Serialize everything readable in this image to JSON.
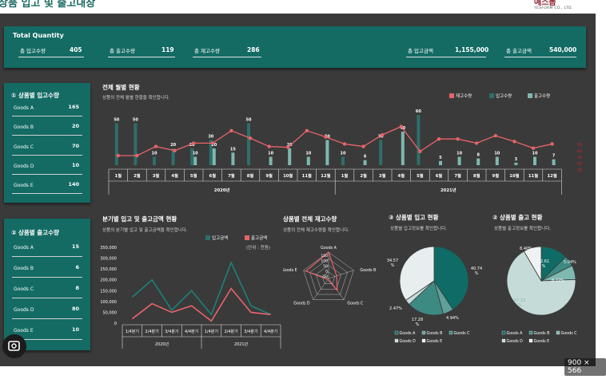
{
  "header": {
    "title": "상품 입고 및 출고내장",
    "logo": "예스폼",
    "logo_sub": "YESFORM CO., LTD."
  },
  "total": {
    "head": "Total Quantity",
    "items": [
      {
        "label": "총 입고수량",
        "value": "405"
      },
      {
        "label": "총 출고수량",
        "value": "119"
      },
      {
        "label": "총 재고수량",
        "value": "286"
      },
      {
        "label": "총 입고금액",
        "value": "1,155,000"
      },
      {
        "label": "총 출고금액",
        "value": "540,000"
      }
    ]
  },
  "inbound": {
    "head": "① 상품별 입고수량",
    "rows": [
      {
        "label": "Goods A",
        "value": "165"
      },
      {
        "label": "Goods B",
        "value": "20"
      },
      {
        "label": "Goods C",
        "value": "70"
      },
      {
        "label": "Goods D",
        "value": "10"
      },
      {
        "label": "Goods E",
        "value": "140"
      }
    ]
  },
  "outbound": {
    "head": "② 상품별 출고수량",
    "rows": [
      {
        "label": "Goods A",
        "value": "15"
      },
      {
        "label": "Goods B",
        "value": "6"
      },
      {
        "label": "Goods C",
        "value": "8"
      },
      {
        "label": "Goods D",
        "value": "80"
      },
      {
        "label": "Goods E",
        "value": "10"
      }
    ]
  },
  "monthly": {
    "title": "전체 월별 현황",
    "subtitle": "상품의 전체 월별 현황을 확인합니다.",
    "legend": [
      "재고수량",
      "입고수량",
      "출고수량"
    ],
    "years": [
      "2020년",
      "2021년"
    ]
  },
  "quarterly": {
    "title": "분기별 입고 및 출고금액 현황",
    "subtitle": "상품의 분기별 입고 및 출고금액을 확인합니다.",
    "legend": [
      "입고금액",
      "출고금액"
    ],
    "unit": "(단위 : 천원)",
    "years": [
      "2020년",
      "2021년"
    ]
  },
  "radar": {
    "title": "상품별 전체 재고수량",
    "subtitle": "상품의 전체 재고수량을 확인합니다."
  },
  "pie_in": {
    "title": "③ 상품별 입고 현황",
    "subtitle": "상품별 입고정보를 확인합니다."
  },
  "pie_out": {
    "title": "② 상품별 출고 현황",
    "subtitle": "상품별 출고정보를 확인합니다."
  },
  "colors": {
    "teal": "#136b64",
    "stock": "#e8646a",
    "inbound": "#2e6f6a",
    "outbound": "#7fb8b0"
  },
  "image_badge": "900 × 566",
  "chart_data": [
    {
      "type": "bar",
      "title": "전체 월별 현황",
      "categories": [
        "1월",
        "2월",
        "3월",
        "4월",
        "5월",
        "6월",
        "7월",
        "8월",
        "9월",
        "10월",
        "11월",
        "12월",
        "1월",
        "2월",
        "3월",
        "4월",
        "5월",
        "6월",
        "7월",
        "8월",
        "9월",
        "10월",
        "11월",
        "12월"
      ],
      "groups": [
        "2020년",
        "2021년"
      ],
      "series": [
        {
          "name": "입고수량",
          "values": [
            50,
            50,
            10,
            20,
            20,
            30,
            0,
            50,
            0,
            0,
            0,
            0,
            10,
            0,
            30,
            0,
            60,
            0,
            0,
            0,
            0,
            0,
            0,
            0
          ]
        },
        {
          "name": "출고수량",
          "values": [
            0,
            0,
            0,
            0,
            10,
            20,
            15,
            0,
            10,
            20,
            10,
            30,
            0,
            6,
            0,
            40,
            0,
            5,
            10,
            8,
            10,
            3,
            10,
            7
          ]
        },
        {
          "name": "재고수량",
          "values": [
            50,
            50,
            72,
            62,
            80,
            80,
            110,
            92,
            72,
            70,
            110,
            95,
            78,
            72,
            100,
            120,
            60,
            90,
            90,
            80,
            98,
            84,
            68,
            78
          ]
        }
      ],
      "data_labels": {
        "입고수량": [
          "50",
          "50",
          "10",
          "20",
          "20",
          "30",
          "",
          "50",
          "",
          "",
          "",
          "",
          "10",
          "",
          "30",
          "",
          "60",
          "",
          "",
          "",
          "",
          "",
          "",
          ""
        ],
        "출고수량": [
          "",
          "",
          "",
          "",
          "10",
          "20",
          "15",
          "",
          "10",
          "20",
          "10",
          "30",
          "",
          "6",
          "",
          "40",
          "",
          "5",
          "10",
          "8",
          "10",
          "3",
          "10",
          "7"
        ]
      },
      "right_axis_labels": [
        "50",
        "40",
        "30",
        "20",
        "10"
      ]
    },
    {
      "type": "line",
      "title": "분기별 입고 및 출고금액 현황",
      "categories": [
        "1/4분기",
        "2/4분기",
        "3/4분기",
        "4/4분기",
        "1/4분기",
        "2/4분기",
        "3/4분기",
        "4/4분기"
      ],
      "groups": [
        "2020년",
        "2021년"
      ],
      "series": [
        {
          "name": "입고금액",
          "values": [
            120000,
            200000,
            60000,
            150000,
            40000,
            280000,
            80000,
            40000
          ]
        },
        {
          "name": "출고금액",
          "values": [
            20000,
            90000,
            50000,
            80000,
            10000,
            160000,
            50000,
            40000
          ]
        }
      ],
      "y_ticks": [
        "350,000",
        "300,000",
        "250,000",
        "200,000",
        "150,000",
        "100,000",
        "50,000",
        "0"
      ],
      "ylim": [
        0,
        350000
      ]
    },
    {
      "type": "radar",
      "title": "상품별 전체 재고수량",
      "categories": [
        "Goods A",
        "Goods B",
        "Goods C",
        "Goods D",
        "Goods E"
      ],
      "values": [
        150,
        14,
        62,
        -70,
        130
      ],
      "ticks": [
        "150",
        "100",
        "50",
        "0",
        "-50"
      ]
    },
    {
      "type": "pie",
      "title": "③ 상품별 입고 현황",
      "categories": [
        "Goods A",
        "Goods B",
        "Goods C",
        "Goods D",
        "Goods E"
      ],
      "values": [
        40.74,
        4.94,
        17.28,
        2.47,
        34.57
      ],
      "labels": [
        "40.74\n%",
        "4.94%",
        "17.28\n%",
        "2.47%",
        "34.57\n%"
      ]
    },
    {
      "type": "pie",
      "title": "② 상품별 출고 현황",
      "categories": [
        "Goods A",
        "Goods B",
        "Goods C",
        "Goods D",
        "Goods E"
      ],
      "values": [
        12.61,
        5.04,
        6.72,
        67.23,
        8.4
      ],
      "labels": [
        "12.61\n%",
        "5.04%",
        "6.72%",
        "67.23\n%",
        "8.40%"
      ]
    }
  ]
}
